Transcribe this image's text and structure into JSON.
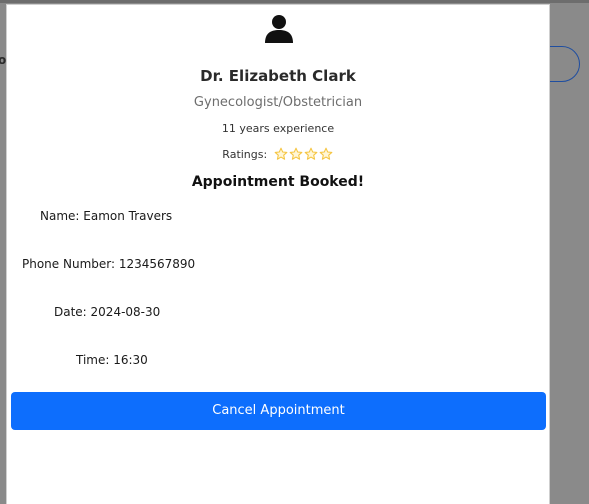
{
  "background": {
    "fragment_text": "or"
  },
  "doctor": {
    "icon": "person-icon",
    "name": "Dr. Elizabeth Clark",
    "specialty": "Gynecologist/Obstetrician",
    "experience": "11 years experience",
    "ratings_label": "Ratings:",
    "rating": 4,
    "star_icon": "star-icon",
    "star_color": "#f5c542"
  },
  "booking": {
    "title": "Appointment Booked!",
    "name_line": "Name: Eamon Travers",
    "phone_line": "Phone Number: 1234567890",
    "date_line": "Date: 2024-08-30",
    "time_line": "Time: 16:30"
  },
  "actions": {
    "cancel_label": "Cancel Appointment",
    "cancel_color": "#0d6efd"
  }
}
